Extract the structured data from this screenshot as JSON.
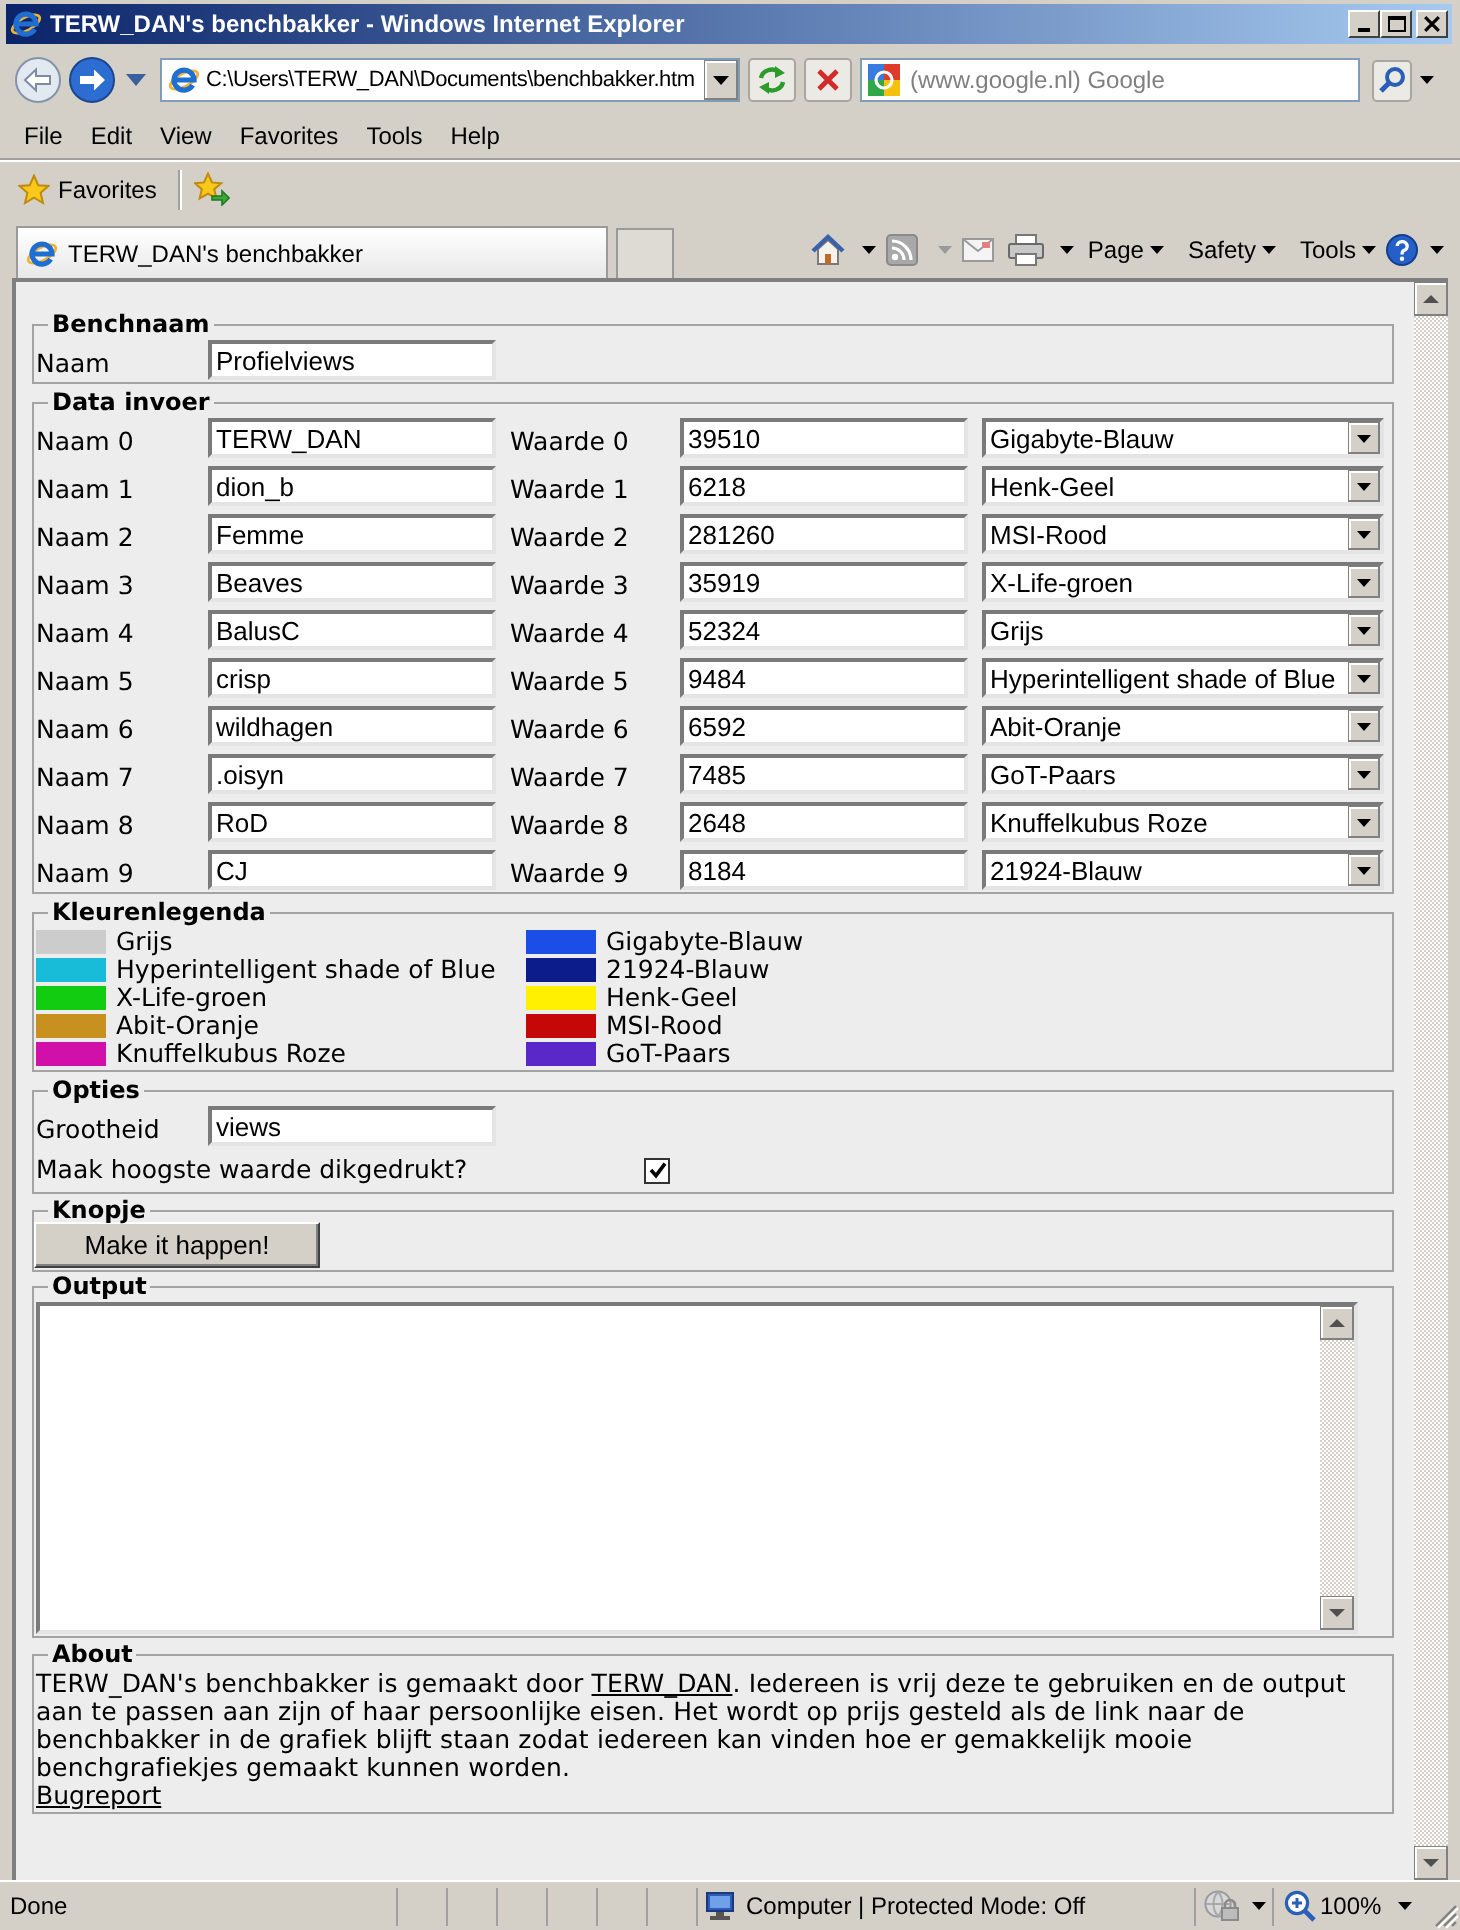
{
  "window": {
    "title": "TERW_DAN's benchbakker - Windows Internet Explorer"
  },
  "address_bar": {
    "value": "C:\\Users\\TERW_DAN\\Documents\\benchbakker.htm"
  },
  "search": {
    "placeholder": "(www.google.nl) Google"
  },
  "menu": [
    "File",
    "Edit",
    "View",
    "Favorites",
    "Tools",
    "Help"
  ],
  "favorites_bar": {
    "label": "Favorites"
  },
  "tabs": [
    {
      "label": "TERW_DAN's benchbakker",
      "selected": true
    }
  ],
  "command_bar": [
    "Page",
    "Safety",
    "Tools"
  ],
  "page": {
    "benchnaam": {
      "legend": "Benchnaam",
      "label": "Naam",
      "value": "Profielviews"
    },
    "data_invoer": {
      "legend": "Data invoer",
      "rows": [
        {
          "name_label": "Naam 0",
          "name": "TERW_DAN",
          "value_label": "Waarde 0",
          "value": "39510",
          "color_choice": "Gigabyte-Blauw"
        },
        {
          "name_label": "Naam 1",
          "name": "dion_b",
          "value_label": "Waarde 1",
          "value": "6218",
          "color_choice": "Henk-Geel"
        },
        {
          "name_label": "Naam 2",
          "name": "Femme",
          "value_label": "Waarde 2",
          "value": "281260",
          "color_choice": "MSI-Rood"
        },
        {
          "name_label": "Naam 3",
          "name": "Beaves",
          "value_label": "Waarde 3",
          "value": "35919",
          "color_choice": "X-Life-groen"
        },
        {
          "name_label": "Naam 4",
          "name": "BalusC",
          "value_label": "Waarde 4",
          "value": "52324",
          "color_choice": "Grijs"
        },
        {
          "name_label": "Naam 5",
          "name": "crisp",
          "value_label": "Waarde 5",
          "value": "9484",
          "color_choice": "Hyperintelligent shade of Blue"
        },
        {
          "name_label": "Naam 6",
          "name": "wildhagen",
          "value_label": "Waarde 6",
          "value": "6592",
          "color_choice": "Abit-Oranje"
        },
        {
          "name_label": "Naam 7",
          "name": ".oisyn",
          "value_label": "Waarde 7",
          "value": "7485",
          "color_choice": "GoT-Paars"
        },
        {
          "name_label": "Naam 8",
          "name": "RoD",
          "value_label": "Waarde 8",
          "value": "2648",
          "color_choice": "Knuffelkubus Roze"
        },
        {
          "name_label": "Naam 9",
          "name": "CJ",
          "value_label": "Waarde 9",
          "value": "8184",
          "color_choice": "21924-Blauw"
        }
      ]
    },
    "kleurenlegenda": {
      "legend": "Kleurenlegenda",
      "items": [
        {
          "label": "Grijs",
          "color": "#cccccc"
        },
        {
          "label": "Hyperintelligent shade of Blue",
          "color": "#18bcd8"
        },
        {
          "label": "X-Life-groen",
          "color": "#12cc12"
        },
        {
          "label": "Abit-Oranje",
          "color": "#c8901e"
        },
        {
          "label": "Knuffelkubus Roze",
          "color": "#d010a8"
        },
        {
          "label": "Gigabyte-Blauw",
          "color": "#1a4ee6"
        },
        {
          "label": "21924-Blauw",
          "color": "#0c1c8a"
        },
        {
          "label": "Henk-Geel",
          "color": "#fff000"
        },
        {
          "label": "MSI-Rood",
          "color": "#c40808"
        },
        {
          "label": "GoT-Paars",
          "color": "#5a28c8"
        }
      ]
    },
    "opties": {
      "legend": "Opties",
      "grootheid": {
        "label": "Grootheid",
        "value": "views"
      },
      "bold_max": {
        "label": "Maak hoogste waarde dikgedrukt?",
        "checked": true
      }
    },
    "knopje": {
      "legend": "Knopje",
      "button": "Make it happen!"
    },
    "output": {
      "legend": "Output"
    },
    "about": {
      "legend": "About",
      "text_before": "TERW_DAN's benchbakker is gemaakt door ",
      "link": "TERW_DAN",
      "text_after": ". Iedereen is vrij deze te gebruiken en de output aan te passen aan zijn of haar persoonlijke eisen. Het wordt op prijs gesteld als de link naar de benchbakker in de grafiek blijft staan zodat iedereen kan vinden hoe er gemakkelijk mooie benchgrafiekjes gemaakt kunnen worden.",
      "bugreport": "Bugreport"
    }
  },
  "status_bar": {
    "text": "Done",
    "zone": "Computer | Protected Mode: Off",
    "zoom": "100%"
  }
}
